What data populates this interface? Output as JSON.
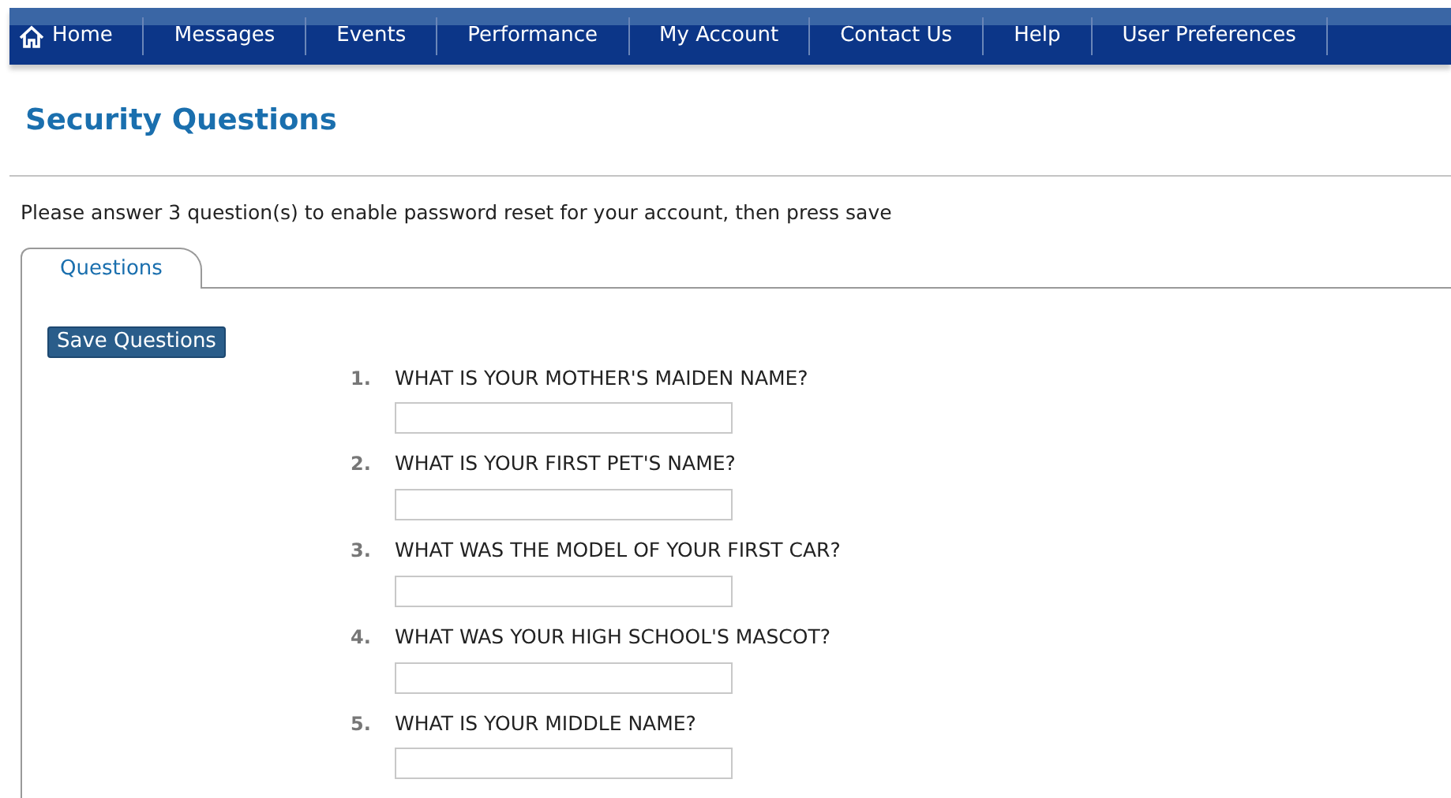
{
  "nav": [
    {
      "label": "Home",
      "kind": "home"
    },
    {
      "label": "Messages",
      "kind": "link"
    },
    {
      "label": "Events",
      "kind": "link"
    },
    {
      "label": "Performance",
      "kind": "link"
    },
    {
      "label": "My Account",
      "kind": "link"
    },
    {
      "label": "Contact Us",
      "kind": "link"
    },
    {
      "label": "Help",
      "kind": "link"
    },
    {
      "label": "User Preferences",
      "kind": "link"
    }
  ],
  "title": "Security Questions",
  "instructions": "Please answer 3 question(s) to enable password reset for your account, then press save",
  "tabs": [
    {
      "label": "Questions",
      "selected": true
    }
  ],
  "save_button": "Save Questions",
  "questions": [
    {
      "number": "1.",
      "text": "WHAT IS YOUR MOTHER'S MAIDEN NAME?"
    },
    {
      "number": "2.",
      "text": "WHAT IS YOUR FIRST PET'S NAME?"
    },
    {
      "number": "3.",
      "text": "WHAT WAS THE MODEL OF YOUR FIRST CAR?"
    },
    {
      "number": "4.",
      "text": "WHAT WAS YOUR HIGH SCHOOL'S MASCOT?"
    },
    {
      "number": "5.",
      "text": "WHAT IS YOUR MIDDLE NAME?"
    }
  ]
}
